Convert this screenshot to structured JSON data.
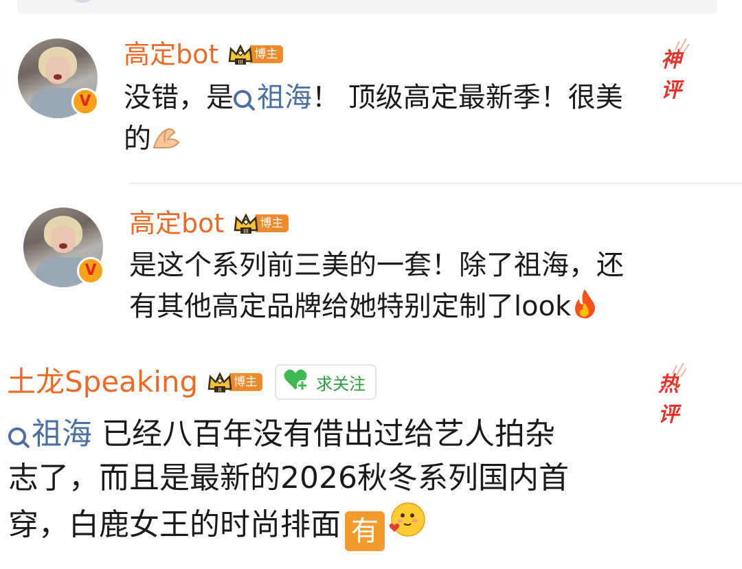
{
  "comments": [
    {
      "username": "高定bot",
      "badge_label": "博主",
      "badge_level": "III",
      "hot_tag": "神评",
      "segments": {
        "before": "没错，是",
        "topic": "祖海",
        "after_line1": "！ 顶级高定最新季！很美",
        "line2": "的"
      }
    },
    {
      "username": "高定bot",
      "badge_label": "博主",
      "badge_level": "III",
      "line1": "是这个系列前三美的一套！除了祖海，还",
      "line2": "有其他高定品牌给她特别定制了look"
    },
    {
      "username": "土龙Speaking",
      "badge_label": "博主",
      "badge_level": "II",
      "follow_label": "求关注",
      "hot_tag": "热评",
      "topic": "祖海",
      "line1_after": " 已经八百年没有借出过给艺人拍杂",
      "line2": "志了，而且是最新的2026秋冬系列国内首",
      "line3": "穿，白鹿女王的时尚排面",
      "tag": "有"
    }
  ],
  "icons": {
    "verified": "verified-v-icon",
    "crown": "crown-icon",
    "follow": "heart-plus-icon",
    "topic": "search-icon",
    "emoji1": "pinching-hand-emoji",
    "emoji2": "fire-emoji",
    "emoji3": "smiling-face-heart-emoji"
  },
  "colors": {
    "username": "#ea6a28",
    "topic": "#4a6fa0",
    "hot_tag": "#e2352c",
    "follow": "#2a9d3b",
    "badge": "#ec8a2e"
  }
}
